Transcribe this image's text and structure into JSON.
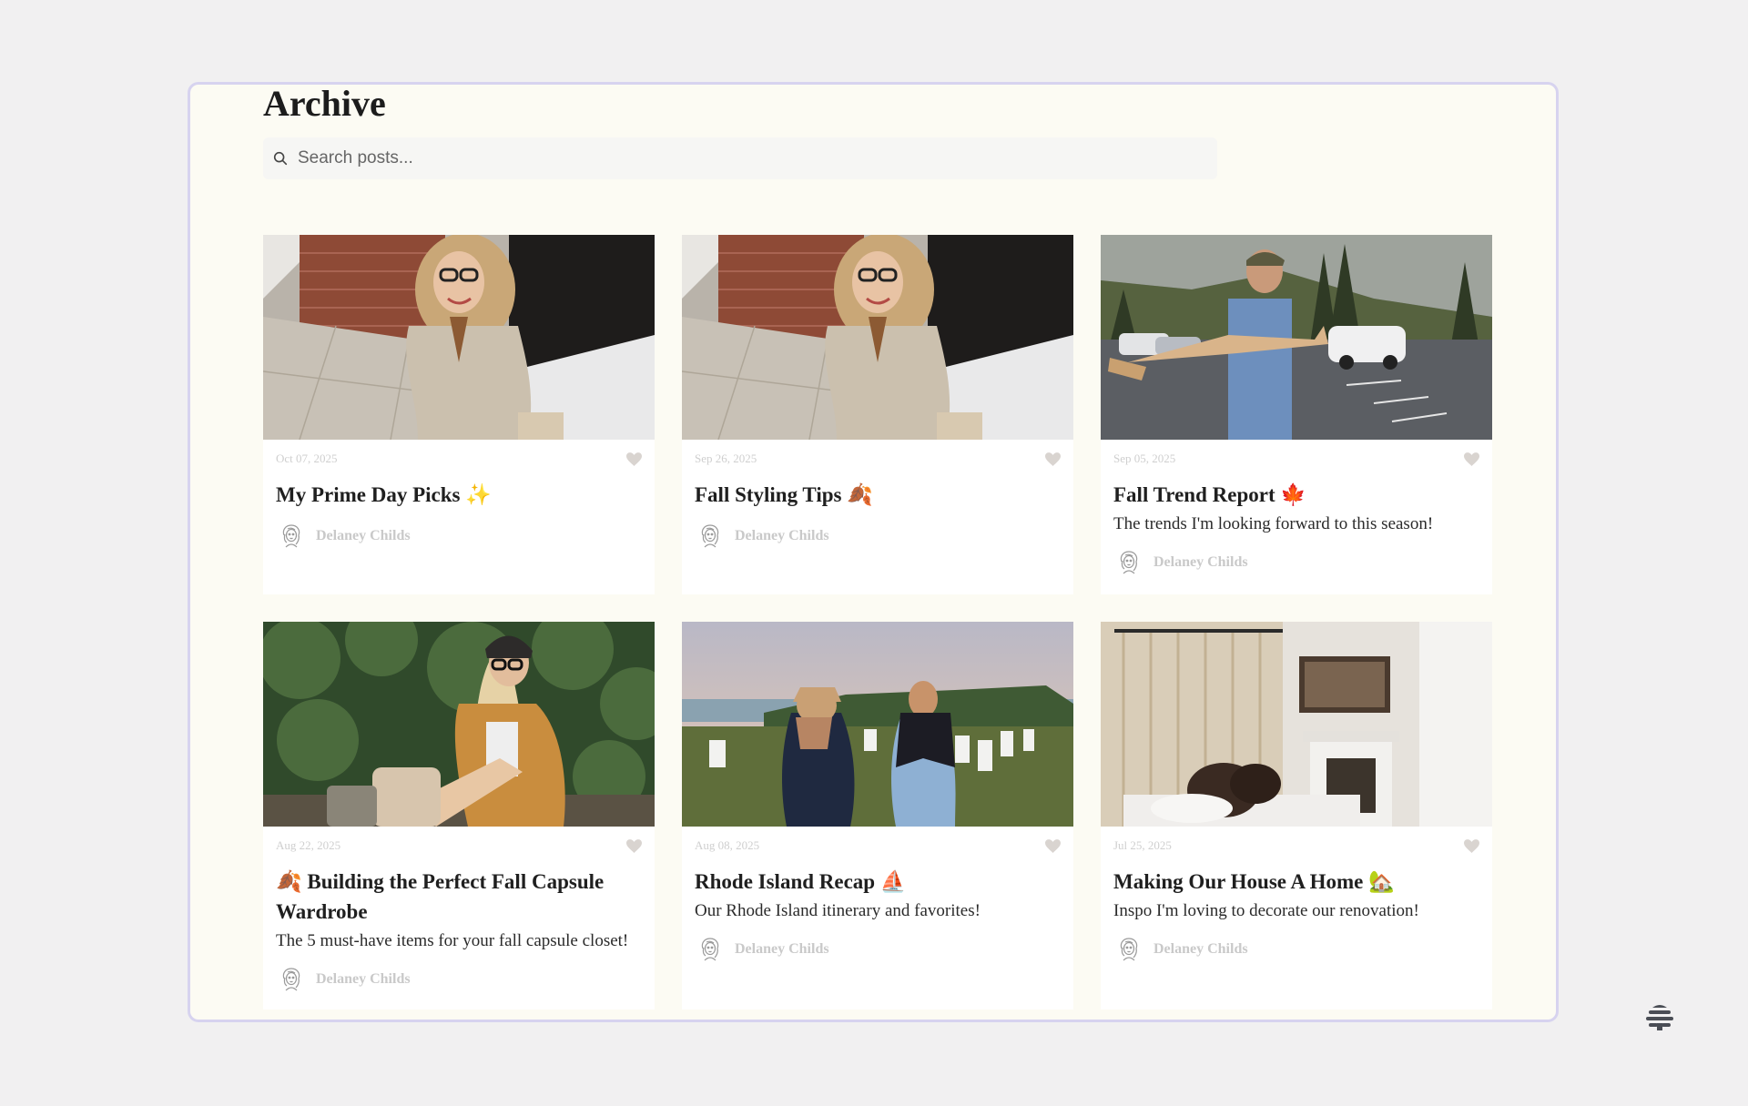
{
  "archive": {
    "title": "Archive",
    "search_placeholder": "Search posts..."
  },
  "icons": {
    "search": "search-icon",
    "like": "heart-icon",
    "avatar": "avatar-icon",
    "brand": "beehive-logo-icon"
  },
  "colors": {
    "page_background": "#f1f0f1",
    "panel_background": "#fcfbf3",
    "panel_border": "#d7d3ef",
    "card_background": "#ffffff",
    "muted_text": "#c9c9c9",
    "heart": "#d7d3d0"
  },
  "posts": [
    {
      "date": "Oct 07, 2025",
      "title": "My Prime Day Picks ✨",
      "excerpt": "",
      "author": "Delaney Childs"
    },
    {
      "date": "Sep 26, 2025",
      "title": "Fall Styling Tips 🍂",
      "excerpt": "",
      "author": "Delaney Childs"
    },
    {
      "date": "Sep 05, 2025",
      "title": "Fall Trend Report 🍁",
      "excerpt": "The trends I'm looking forward to this season!",
      "author": "Delaney Childs"
    },
    {
      "date": "Aug 22, 2025",
      "title": "🍂 Building the Perfect Fall Capsule Wardrobe",
      "excerpt": "The 5 must-have items for your fall capsule closet!",
      "author": "Delaney Childs"
    },
    {
      "date": "Aug 08, 2025",
      "title": "Rhode Island Recap ⛵",
      "excerpt": "Our Rhode Island itinerary and favorites!",
      "author": "Delaney Childs"
    },
    {
      "date": "Jul 25, 2025",
      "title": "Making Our House A Home 🏡",
      "excerpt": "Inspo I'm loving to decorate our renovation!",
      "author": "Delaney Childs"
    }
  ]
}
